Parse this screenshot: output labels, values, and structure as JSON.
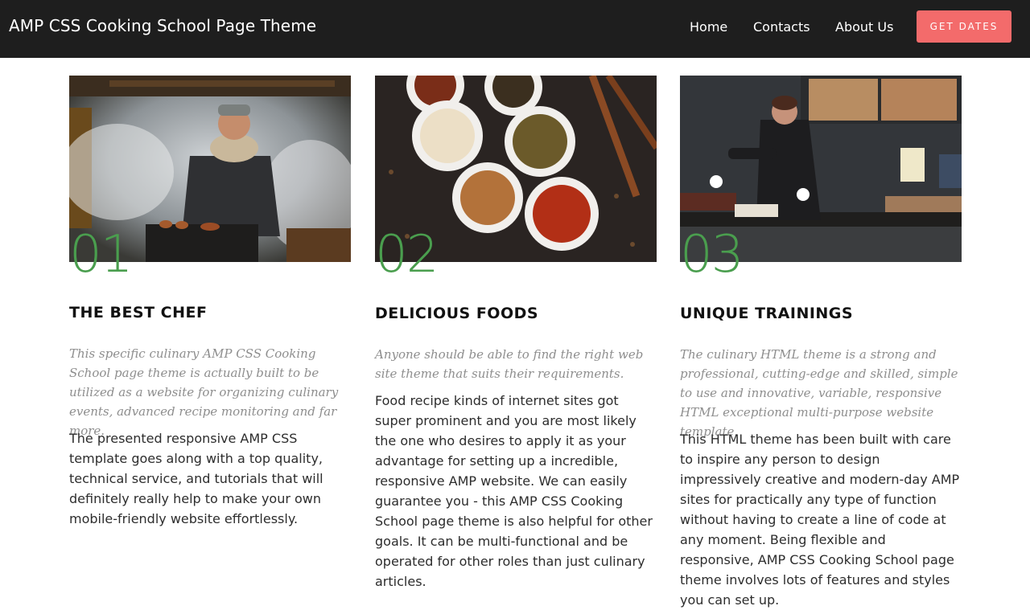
{
  "navbar": {
    "brand": "AMP CSS Cooking School Page Theme",
    "links": [
      "Home",
      "Contacts",
      "About Us"
    ],
    "cta": "GET DATES"
  },
  "cards": [
    {
      "number": "01",
      "title": "THE BEST CHEF",
      "lead": "This specific culinary AMP CSS Cooking School page theme is actually built to be utilized as a website for organizing culinary events, advanced recipe monitoring and far more.",
      "body": "The presented responsive AMP CSS template goes along with a top quality, technical service, and tutorials that will definitely really help to make your own mobile-friendly website effortlessly.",
      "image": "chef-grilling-photo"
    },
    {
      "number": "02",
      "title": "DELICIOUS FOODS",
      "lead": "Anyone should be able to find the right web site theme that suits their requirements.",
      "body": "Food recipe kinds of internet sites got super prominent and you are most likely the one who desires to apply it as your advantage for setting up a incredible, responsive AMP website. We can easily guarantee you - this AMP CSS Cooking School page theme is also helpful for other goals. It can be multi-functional and be operated for other roles than just culinary articles.",
      "image": "spice-bowls-photo"
    },
    {
      "number": "03",
      "title": "UNIQUE TRAININGS",
      "lead": "The culinary HTML theme is a strong and professional, cutting-edge and skilled, simple to use and innovative, variable, responsive HTML exceptional multi-purpose website template.",
      "body": "This HTML theme has been built with care to inspire any person to design impressively creative and modern-day AMP sites for practically any type of function without having to create a line of code at any moment. Being flexible and responsive, AMP CSS Cooking School page theme involves lots of features and styles you can set up.",
      "image": "street-food-cook-photo"
    }
  ],
  "colors": {
    "navbar_bg": "#1e1e1e",
    "cta_bg": "#f36b6b",
    "number_green": "#4a9e4e"
  }
}
